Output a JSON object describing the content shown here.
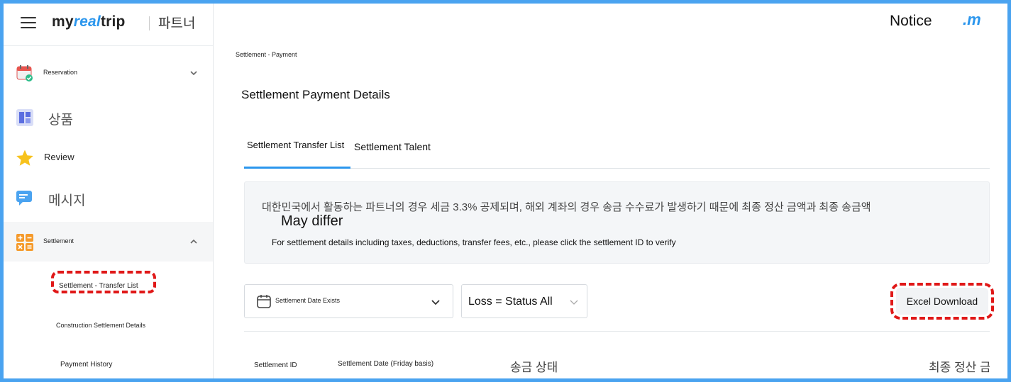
{
  "header": {
    "logo_prefix": "my",
    "logo_accent": "real",
    "logo_suffix": "trip",
    "partner_label": "파트너",
    "notice": "Notice",
    "brand_mark": ".m"
  },
  "sidebar": {
    "items": [
      {
        "label": "Reservation",
        "icon": "calendar-check-icon"
      },
      {
        "label": "상품",
        "icon": "product-grid-icon"
      },
      {
        "label": "Review",
        "icon": "star-icon"
      },
      {
        "label": "메시지",
        "icon": "message-icon"
      },
      {
        "label": "Settlement",
        "icon": "calculator-icon"
      }
    ],
    "sub_items": [
      {
        "label": "Settlement - Transfer List"
      },
      {
        "label": "Construction Settlement Details"
      },
      {
        "label": "Payment History"
      }
    ]
  },
  "main": {
    "breadcrumb": "Settlement - Payment",
    "title": "Settlement Payment Details",
    "tabs": [
      {
        "label": "Settlement Transfer List",
        "active": true
      },
      {
        "label": "Settlement Talent",
        "active": false
      }
    ],
    "info": {
      "korean": "대한민국에서 활동하는 파트너의 경우 세금 3.3% 공제되며, 해외 계좌의 경우 송금 수수료가 발생하기 때문에 최종 정산 금액과 최종 송금액",
      "differ": "May differ",
      "english": "For settlement details including taxes, deductions, transfer fees, etc., please click the settlement ID to verify"
    },
    "filters": {
      "date_select": "Settlement Date Exists",
      "status_select": "Loss = Status All"
    },
    "excel_button": "Excel Download",
    "table": {
      "columns": [
        "Settlement ID",
        "Settlement Date (Friday basis)",
        "송금 상태",
        "최종 정산 금"
      ]
    }
  },
  "colors": {
    "accent": "#2b96ed",
    "highlight": "#e01818",
    "frame": "#4aa3f0"
  }
}
